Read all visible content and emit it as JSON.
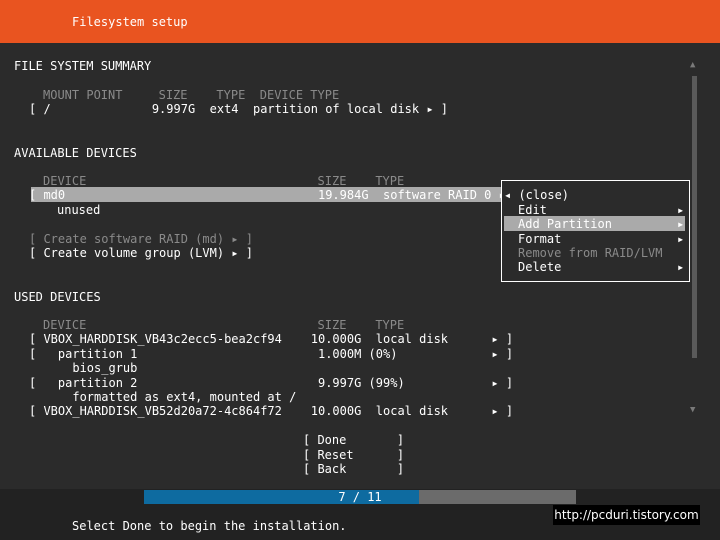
{
  "header": {
    "title": "Filesystem setup"
  },
  "fs_summary": {
    "heading": "FILE SYSTEM SUMMARY",
    "columns": "MOUNT POINT     SIZE    TYPE  DEVICE TYPE",
    "row": "[ /              9.997G  ext4  partition of local disk ▸ ]"
  },
  "available": {
    "heading": "AVAILABLE DEVICES",
    "columns": "DEVICE                                SIZE    TYPE",
    "md0_row": "[ md0                                   19.984G  software RAID 0 ▸",
    "md0_status": "unused",
    "create_raid": "[ Create software RAID (md) ▸ ]",
    "create_lvm": "[ Create volume group (LVM) ▸ ]"
  },
  "context_menu": {
    "items": [
      {
        "label": "◂ (close)",
        "enabled": true
      },
      {
        "label": "Edit",
        "enabled": true,
        "arrow": "▸"
      },
      {
        "label": "Add Partition",
        "enabled": true,
        "arrow": "▸"
      },
      {
        "label": "Format",
        "enabled": true,
        "arrow": "▸"
      },
      {
        "label": "Remove from RAID/LVM",
        "enabled": false
      },
      {
        "label": "Delete",
        "enabled": true,
        "arrow": "▸"
      }
    ]
  },
  "used": {
    "heading": "USED DEVICES",
    "columns": "DEVICE                                SIZE    TYPE",
    "rows": [
      {
        "text": "[ VBOX_HARDDISK_VB43c2ecc5-bea2cf94    10.000G  local disk      ▸ ]"
      },
      {
        "text": "[   partition 1                         1.000M (0%)             ▸ ]"
      },
      {
        "text": "      bios_grub"
      },
      {
        "text": "[   partition 2                         9.997G (99%)            ▸ ]"
      },
      {
        "text": "      formatted as ext4, mounted at /"
      },
      {
        "text": "[ VBOX_HARDDISK_VB52d20a72-4c864f72    10.000G  local disk      ▸ ]"
      }
    ]
  },
  "buttons": {
    "done": "[ Done       ]",
    "reset": "[ Reset      ]",
    "back": "[ Back       ]"
  },
  "progress": {
    "text": "7 / 11",
    "fraction": 0.636
  },
  "status": "Select Done to begin the installation.",
  "watermark": "http://pcduri.tistory.com",
  "scroll": {
    "up": "▲",
    "down": "▼"
  },
  "colors": {
    "header": "#e95420",
    "background": "#2b2b2b",
    "highlight": "#aaaaaa",
    "progress_fill": "#0e6ba0",
    "progress_track": "#6b6b6b"
  }
}
